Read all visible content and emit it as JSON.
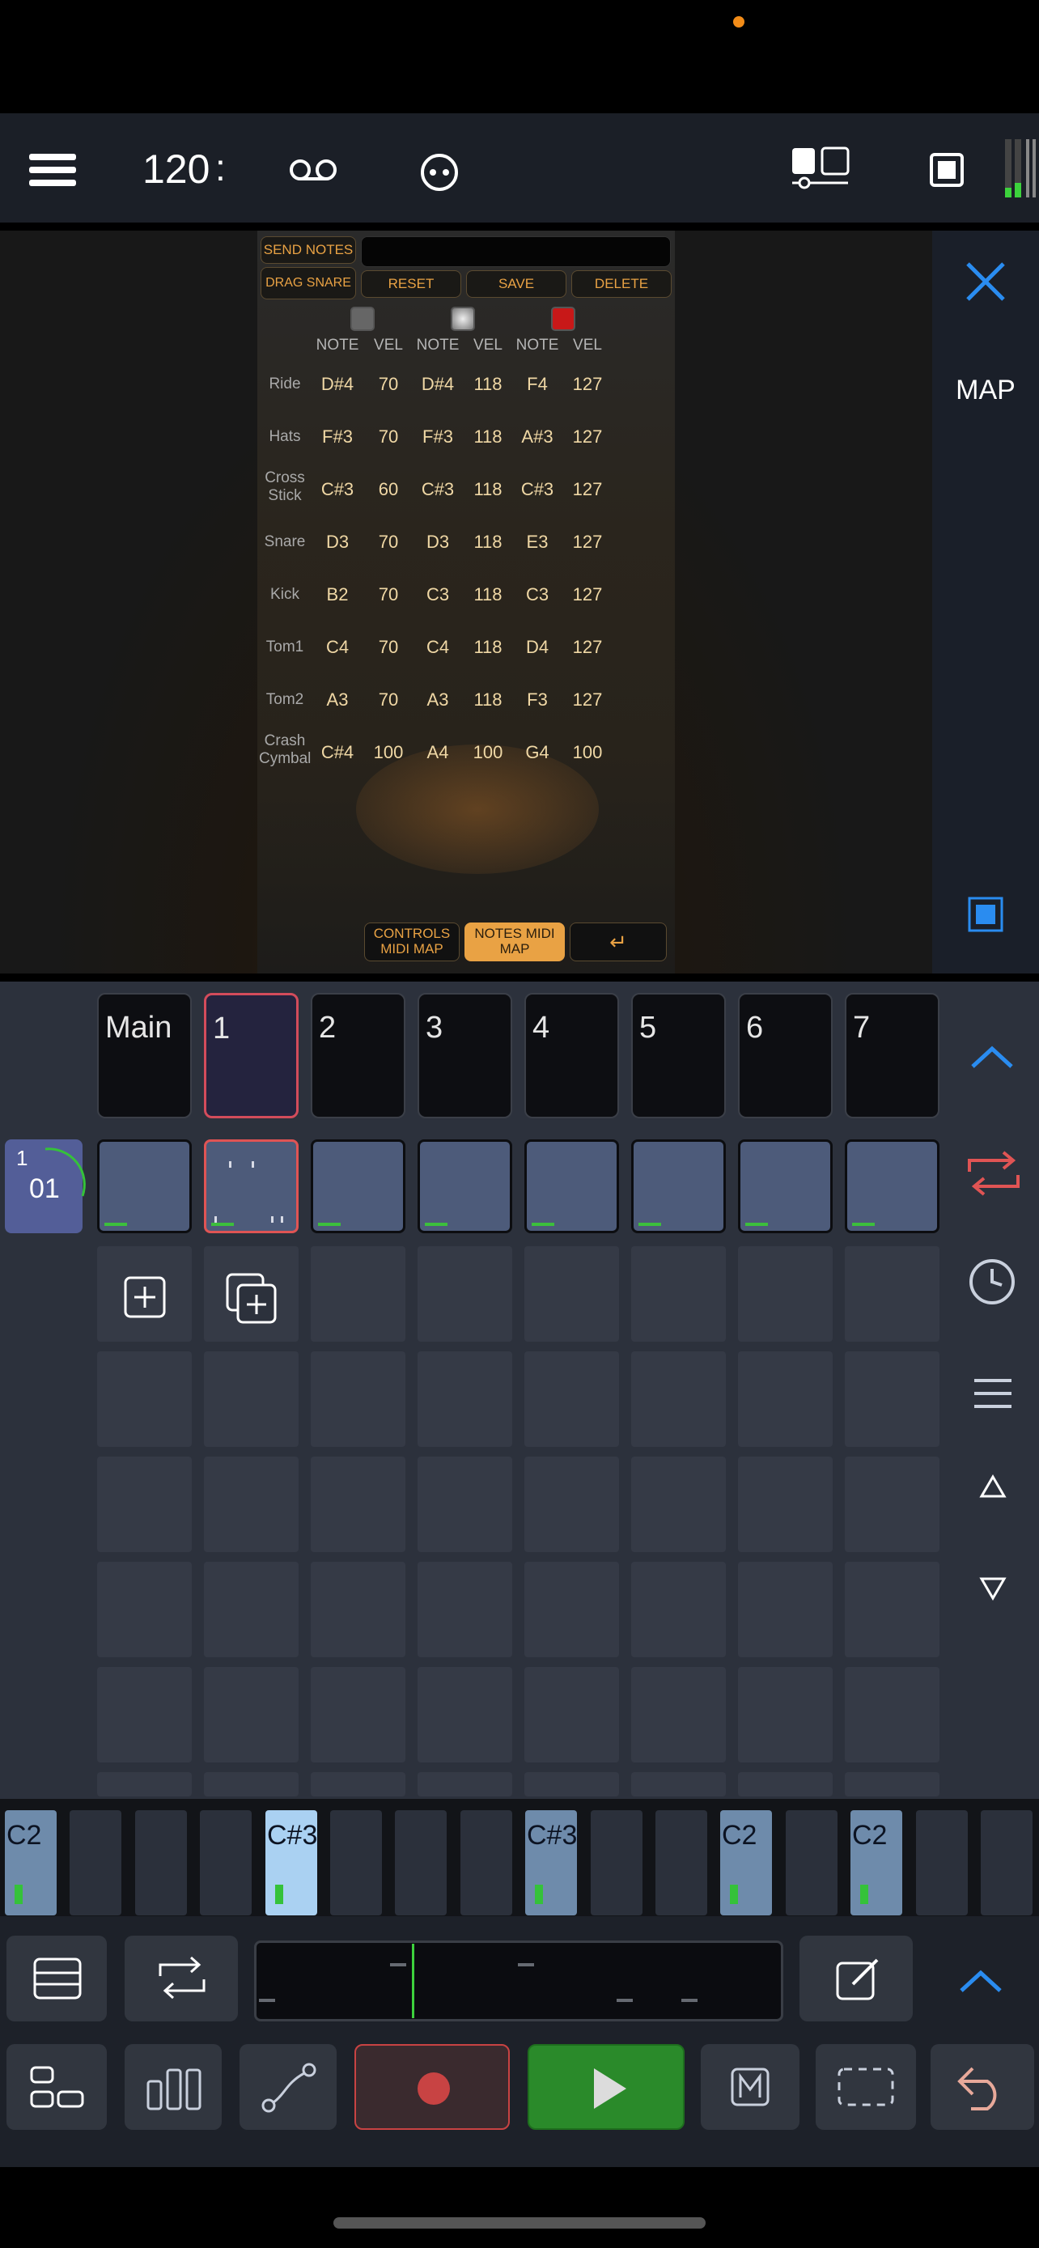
{
  "toolbar": {
    "tempo": "120",
    "tempo_sep": ":"
  },
  "plugin": {
    "send_notes": "SEND NOTES",
    "drag_snare": "DRAG SNARE",
    "reset": "RESET",
    "save": "SAVE",
    "delete": "DELETE",
    "headers": [
      "NOTE",
      "VEL",
      "NOTE",
      "VEL",
      "NOTE",
      "VEL"
    ],
    "rows": [
      {
        "label": "Ride",
        "cells": [
          "D#4",
          "70",
          "D#4",
          "118",
          "F4",
          "127"
        ]
      },
      {
        "label": "Hats",
        "cells": [
          "F#3",
          "70",
          "F#3",
          "118",
          "A#3",
          "127"
        ]
      },
      {
        "label": "Cross Stick",
        "cells": [
          "C#3",
          "60",
          "C#3",
          "118",
          "C#3",
          "127"
        ]
      },
      {
        "label": "Snare",
        "cells": [
          "D3",
          "70",
          "D3",
          "118",
          "E3",
          "127"
        ]
      },
      {
        "label": "Kick",
        "cells": [
          "B2",
          "70",
          "C3",
          "118",
          "C3",
          "127"
        ]
      },
      {
        "label": "Tom1",
        "cells": [
          "C4",
          "70",
          "C4",
          "118",
          "D4",
          "127"
        ]
      },
      {
        "label": "Tom2",
        "cells": [
          "A3",
          "70",
          "A3",
          "118",
          "F3",
          "127"
        ]
      },
      {
        "label": "Crash Cymbal",
        "cells": [
          "C#4",
          "100",
          "A4",
          "100",
          "G4",
          "100"
        ]
      }
    ],
    "controls_midi_map": "CONTROLS MIDI MAP",
    "notes_midi_map": "NOTES MIDI MAP",
    "enter_glyph": "↵"
  },
  "side": {
    "map_label": "MAP"
  },
  "scenes": [
    "Main",
    "1",
    "2",
    "3",
    "4",
    "5",
    "6",
    "7"
  ],
  "track": {
    "top_number": "1",
    "number": "01"
  },
  "note_strip": [
    {
      "label": "C2",
      "state": "on"
    },
    {
      "label": "",
      "state": "off"
    },
    {
      "label": "",
      "state": "off"
    },
    {
      "label": "",
      "state": "off"
    },
    {
      "label": "C#3",
      "state": "hi"
    },
    {
      "label": "",
      "state": "off"
    },
    {
      "label": "",
      "state": "off"
    },
    {
      "label": "",
      "state": "off"
    },
    {
      "label": "C#3",
      "state": "on"
    },
    {
      "label": "",
      "state": "off"
    },
    {
      "label": "",
      "state": "off"
    },
    {
      "label": "C2",
      "state": "on"
    },
    {
      "label": "",
      "state": "off"
    },
    {
      "label": "C2",
      "state": "on"
    },
    {
      "label": "",
      "state": "off"
    },
    {
      "label": "",
      "state": "off"
    }
  ],
  "colors": {
    "accent_blue": "#2a8cf0",
    "accent_orange": "#e9a244",
    "play_green": "#2a8a2a",
    "record_red": "#c84343"
  }
}
